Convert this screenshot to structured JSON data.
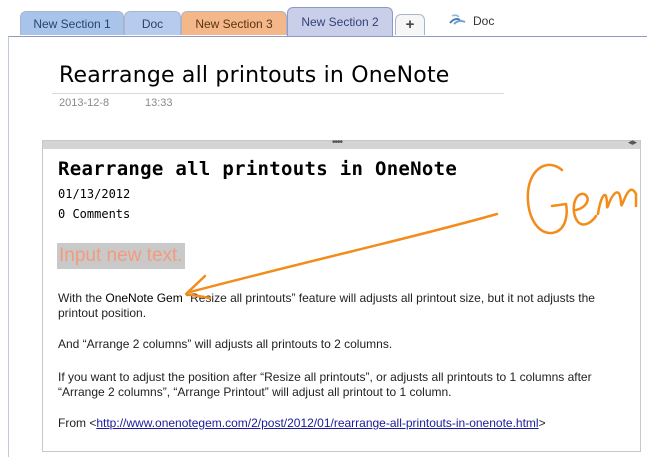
{
  "tabs": [
    {
      "label": "New Section 1"
    },
    {
      "label": "Doc"
    },
    {
      "label": "New Section 3"
    },
    {
      "label": "New Section 2",
      "active": true
    }
  ],
  "add_tab_label": "+",
  "doc_tab": {
    "label": "Doc",
    "icon": "shared-notebook-icon"
  },
  "page": {
    "title": "Rearrange all printouts in OneNote",
    "date": "2013-12-8",
    "time": "13:33"
  },
  "note": {
    "title": "Rearrange all printouts in OneNote",
    "date": "01/13/2012",
    "comments": "0 Comments",
    "input_placeholder": "Input new text.",
    "p1_a": "With the ",
    "p1_link": "OneNote Gem",
    "p1_b": " “Resize all printouts” feature will adjusts all printout size, but it not adjusts the printout position.",
    "p2": "And “Arrange 2 columns” will adjusts all printouts to 2 columns.",
    "p3": "If you want to adjust the position after “Resize all printouts”, or adjusts all printouts to 1 columns after “Arrange 2 columns”, “Arrange Printout” will adjust all printout to 1 column.",
    "p4_a": "From <",
    "p4_url": "http://www.onenotegem.com/2/post/2012/01/rearrange-all-printouts-in-onenote.html",
    "p4_b": ">"
  },
  "ink": {
    "text": "Gem",
    "color": "#f28c1b"
  },
  "colors": {
    "tab1": "#a8c4ea",
    "tab2": "#b6cbee",
    "tab3": "#f3b789",
    "tab4_active": "#c9cfe9",
    "input_text": "#f39b7c",
    "input_highlight": "#c9c9c9",
    "link": "#1b1b9b"
  }
}
